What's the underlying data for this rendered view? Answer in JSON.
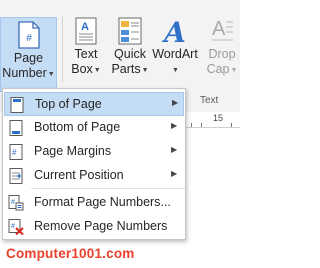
{
  "ribbon": {
    "page_number": {
      "line1": "Page",
      "line2": "Number"
    },
    "text_box": {
      "line1": "Text",
      "line2": "Box"
    },
    "quick_parts": {
      "line1": "Quick",
      "line2": "Parts"
    },
    "wordart": {
      "line1": "WordArt"
    },
    "drop_cap": {
      "line1": "Drop",
      "line2": "Cap"
    },
    "group_label": "Text"
  },
  "ruler": {
    "number": "15"
  },
  "menu": {
    "items": [
      {
        "label": "Top of Page",
        "has_submenu": true,
        "icon": "page-top-icon"
      },
      {
        "label": "Bottom of Page",
        "has_submenu": true,
        "icon": "page-bottom-icon"
      },
      {
        "label": "Page Margins",
        "has_submenu": true,
        "icon": "page-margins-icon"
      },
      {
        "label": "Current Position",
        "has_submenu": true,
        "icon": "current-position-icon"
      },
      {
        "label": "Format Page Numbers...",
        "has_submenu": false,
        "icon": "format-page-numbers-icon"
      },
      {
        "label": "Remove Page Numbers",
        "has_submenu": false,
        "icon": "remove-page-numbers-icon"
      }
    ]
  },
  "brand": "Computer1001.com",
  "colors": {
    "highlight": "#c5dcf5",
    "brand": "#e8412b",
    "accent": "#2e6fc7"
  }
}
